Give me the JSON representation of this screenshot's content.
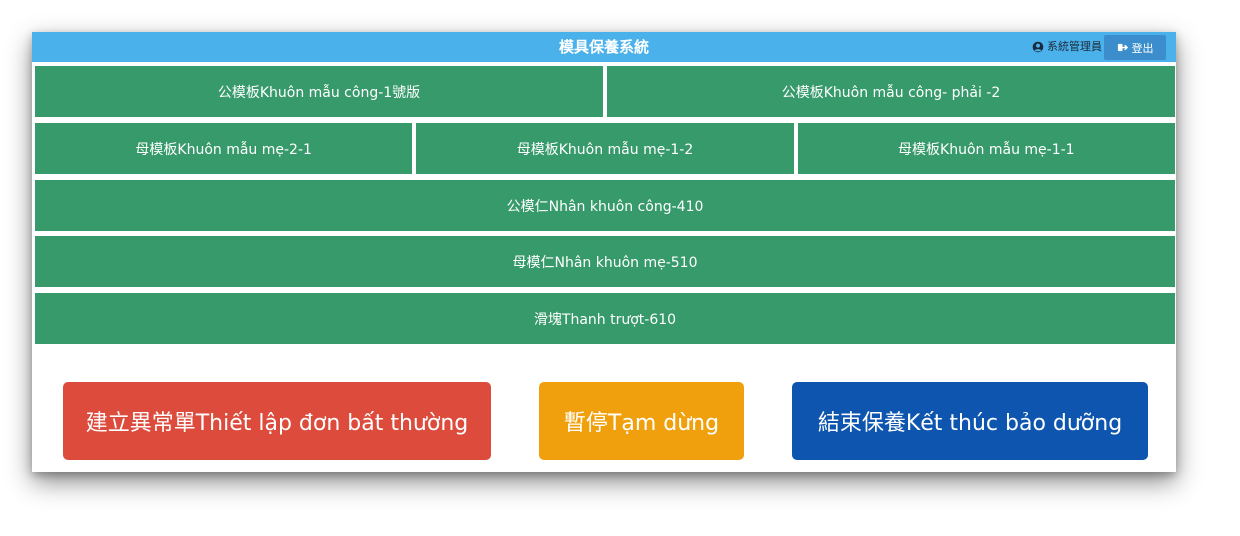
{
  "header": {
    "title": "模具保養系統",
    "user_name": "系統管理員",
    "logout_label": "登出",
    "bar_color": "#4ab1ea"
  },
  "rows": [
    [
      "公模板Khuôn mẫu công-1號版",
      "公模板Khuôn mẫu công- phải -2"
    ],
    [
      "母模板Khuôn mẫu mẹ-2-1",
      "母模板Khuôn mẫu mẹ-1-2",
      "母模板Khuôn mẫu mẹ-1-1"
    ],
    [
      "公模仁Nhân khuôn công-410"
    ],
    [
      "母模仁Nhân khuôn mẹ-510"
    ],
    [
      "滑塊Thanh trượt-610"
    ]
  ],
  "item_color": "#379a6b",
  "actions": [
    {
      "label": "建立異常單Thiết lập đơn bất thường",
      "color": "#dc4b3c"
    },
    {
      "label": "暫停Tạm dừng",
      "color": "#f0a00c"
    },
    {
      "label": "結束保養Kết thúc bảo dưỡng",
      "color": "#0d55ae"
    }
  ]
}
